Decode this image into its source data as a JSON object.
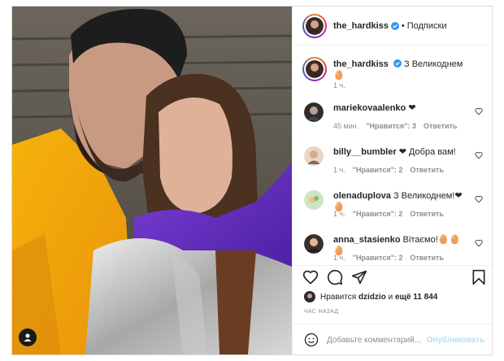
{
  "post": {
    "author": "the_hardkiss",
    "follow_label": "Подписки",
    "caption": "З Великоднем 🥚",
    "caption_time": "1 ч.",
    "likes_prefix": "Нравится",
    "liked_by": "dzidzio",
    "likes_mid": "и",
    "likes_count": "ещё 11 844",
    "date": "ЧАС НАЗАД"
  },
  "comments": [
    {
      "user": "mariekovaalenko",
      "text": "❤",
      "time": "45 мин.",
      "likes": "\"Нравится\": 3",
      "reply": "Ответить"
    },
    {
      "user": "billy__bumbler",
      "text": "❤ Добра вам!",
      "time": "1 ч.",
      "likes": "\"Нравится\": 2",
      "reply": "Ответить"
    },
    {
      "user": "olenaduplova",
      "text": "З Великоднем!❤🥚",
      "time": "1 ч.",
      "likes": "\"Нравится\": 2",
      "reply": "Ответить"
    },
    {
      "user": "anna_stasienko",
      "text": "Вітаємо!🥚🥚🥚",
      "time": "1 ч.",
      "likes": "\"Нравится\": 2",
      "reply": "Ответить"
    }
  ],
  "comment_box": {
    "placeholder": "Добавьте комментарий...",
    "post_label": "Опубликовать"
  },
  "icons": {
    "like": "heart-icon",
    "comment": "comment-icon",
    "share": "share-icon",
    "save": "bookmark-icon",
    "emoji": "emoji-icon",
    "tag": "user-tag-icon",
    "verified": "verified-badge-icon"
  },
  "colors": {
    "verified": "#3897f0",
    "muted": "#8e8e8e",
    "post_disabled": "#b2dffc",
    "text": "#262626"
  }
}
